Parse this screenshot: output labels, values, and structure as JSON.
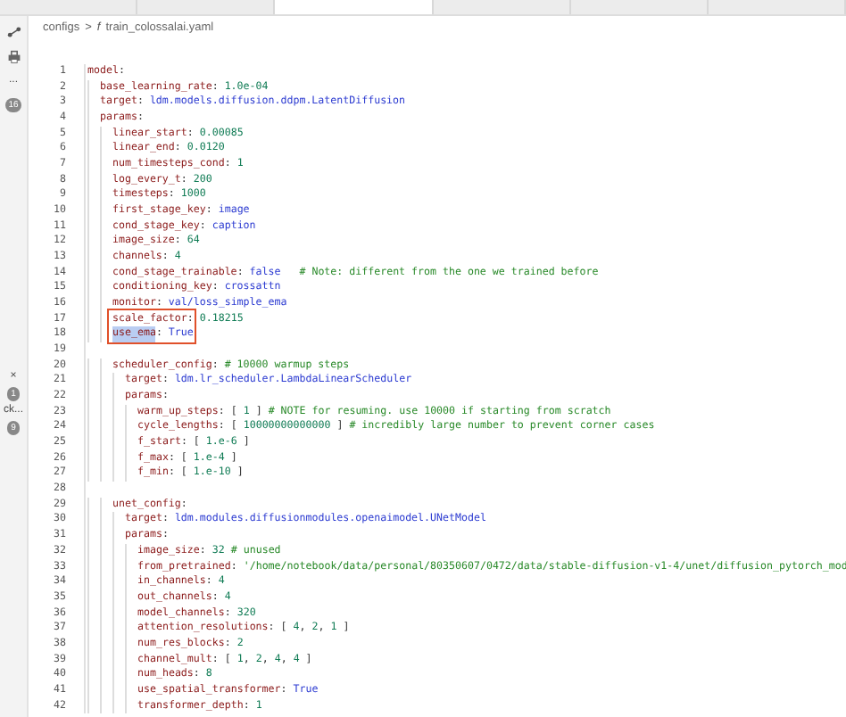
{
  "tabs": [
    {
      "selected": false
    },
    {
      "selected": false
    },
    {
      "selected": true
    },
    {
      "selected": false
    },
    {
      "selected": false
    },
    {
      "selected": false
    }
  ],
  "sidebar": {
    "top": [
      {
        "kind": "nodes"
      },
      {
        "kind": "printer"
      },
      {
        "kind": "text",
        "text": "..."
      },
      {
        "kind": "badge",
        "text": "16"
      }
    ],
    "bottom": [
      {
        "kind": "text",
        "text": "×"
      },
      {
        "kind": "badge",
        "text": "1"
      },
      {
        "kind": "text",
        "text": "ck..."
      },
      {
        "kind": "badge",
        "text": "9"
      }
    ]
  },
  "breadcrumb": {
    "folder": "configs",
    "separator": ">",
    "file_icon": "f",
    "file": "train_colossalai.yaml"
  },
  "lines": [
    {
      "n": "1",
      "tokens": [
        {
          "kind": "key",
          "text": "model"
        },
        {
          "kind": "plain",
          "text": ":"
        }
      ]
    },
    {
      "n": "2",
      "tokens": [
        {
          "kind": "key",
          "text": "  base_learning_rate"
        },
        {
          "kind": "plain",
          "text": ": "
        },
        {
          "kind": "num",
          "text": "1.0e-04"
        }
      ]
    },
    {
      "n": "3",
      "tokens": [
        {
          "kind": "key",
          "text": "  target"
        },
        {
          "kind": "plain",
          "text": ": "
        },
        {
          "kind": "str",
          "text": "ldm.models.diffusion.ddpm.LatentDiffusion"
        }
      ]
    },
    {
      "n": "4",
      "tokens": [
        {
          "kind": "key",
          "text": "  params"
        },
        {
          "kind": "plain",
          "text": ":"
        }
      ]
    },
    {
      "n": "5",
      "tokens": [
        {
          "kind": "key",
          "text": "    linear_start"
        },
        {
          "kind": "plain",
          "text": ": "
        },
        {
          "kind": "num",
          "text": "0.00085"
        }
      ]
    },
    {
      "n": "6",
      "tokens": [
        {
          "kind": "key",
          "text": "    linear_end"
        },
        {
          "kind": "plain",
          "text": ": "
        },
        {
          "kind": "num",
          "text": "0.0120"
        }
      ]
    },
    {
      "n": "7",
      "tokens": [
        {
          "kind": "key",
          "text": "    num_timesteps_cond"
        },
        {
          "kind": "plain",
          "text": ": "
        },
        {
          "kind": "num",
          "text": "1"
        }
      ]
    },
    {
      "n": "8",
      "tokens": [
        {
          "kind": "key",
          "text": "    log_every_t"
        },
        {
          "kind": "plain",
          "text": ": "
        },
        {
          "kind": "num",
          "text": "200"
        }
      ]
    },
    {
      "n": "9",
      "tokens": [
        {
          "kind": "key",
          "text": "    timesteps"
        },
        {
          "kind": "plain",
          "text": ": "
        },
        {
          "kind": "num",
          "text": "1000"
        }
      ]
    },
    {
      "n": "10",
      "tokens": [
        {
          "kind": "key",
          "text": "    first_stage_key"
        },
        {
          "kind": "plain",
          "text": ": "
        },
        {
          "kind": "str",
          "text": "image"
        }
      ]
    },
    {
      "n": "11",
      "tokens": [
        {
          "kind": "key",
          "text": "    cond_stage_key"
        },
        {
          "kind": "plain",
          "text": ": "
        },
        {
          "kind": "str",
          "text": "caption"
        }
      ]
    },
    {
      "n": "12",
      "tokens": [
        {
          "kind": "key",
          "text": "    image_size"
        },
        {
          "kind": "plain",
          "text": ": "
        },
        {
          "kind": "num",
          "text": "64"
        }
      ]
    },
    {
      "n": "13",
      "tokens": [
        {
          "kind": "key",
          "text": "    channels"
        },
        {
          "kind": "plain",
          "text": ": "
        },
        {
          "kind": "num",
          "text": "4"
        }
      ]
    },
    {
      "n": "14",
      "tokens": [
        {
          "kind": "key",
          "text": "    cond_stage_trainable"
        },
        {
          "kind": "plain",
          "text": ": "
        },
        {
          "kind": "str",
          "text": "false   "
        },
        {
          "kind": "comment",
          "text": "# Note: different from the one we trained before"
        }
      ]
    },
    {
      "n": "15",
      "tokens": [
        {
          "kind": "key",
          "text": "    conditioning_key"
        },
        {
          "kind": "plain",
          "text": ": "
        },
        {
          "kind": "str",
          "text": "crossattn"
        }
      ]
    },
    {
      "n": "16",
      "tokens": [
        {
          "kind": "key",
          "text": "    monitor"
        },
        {
          "kind": "plain",
          "text": ": "
        },
        {
          "kind": "str",
          "text": "val/loss_simple_ema"
        }
      ]
    },
    {
      "n": "17",
      "boxed": true,
      "tokens": [
        {
          "kind": "key",
          "text": "    scale_factor"
        },
        {
          "kind": "plain",
          "text": ": "
        },
        {
          "kind": "num",
          "text": "0.18215"
        }
      ]
    },
    {
      "n": "18",
      "tokens": [
        {
          "kind": "key",
          "text": "    use_ema",
          "selected": true
        },
        {
          "kind": "plain",
          "text": ": "
        },
        {
          "kind": "str",
          "text": "True"
        }
      ]
    },
    {
      "n": "19"
    },
    {
      "n": "20",
      "tokens": [
        {
          "kind": "key",
          "text": "    scheduler_config"
        },
        {
          "kind": "plain",
          "text": ": "
        },
        {
          "kind": "comment",
          "text": "# 10000 warmup steps"
        }
      ]
    },
    {
      "n": "21",
      "tokens": [
        {
          "kind": "key",
          "text": "      target"
        },
        {
          "kind": "plain",
          "text": ": "
        },
        {
          "kind": "str",
          "text": "ldm.lr_scheduler.LambdaLinearScheduler"
        }
      ]
    },
    {
      "n": "22",
      "tokens": [
        {
          "kind": "key",
          "text": "      params"
        },
        {
          "kind": "plain",
          "text": ":"
        }
      ]
    },
    {
      "n": "23",
      "tokens": [
        {
          "kind": "key",
          "text": "        warm_up_steps"
        },
        {
          "kind": "plain",
          "text": ": [ "
        },
        {
          "kind": "num",
          "text": "1"
        },
        {
          "kind": "plain",
          "text": " ] "
        },
        {
          "kind": "comment",
          "text": "# NOTE for resuming. use 10000 if starting from scratch"
        }
      ]
    },
    {
      "n": "24",
      "tokens": [
        {
          "kind": "key",
          "text": "        cycle_lengths"
        },
        {
          "kind": "plain",
          "text": ": [ "
        },
        {
          "kind": "num",
          "text": "10000000000000"
        },
        {
          "kind": "plain",
          "text": " ] "
        },
        {
          "kind": "comment",
          "text": "# incredibly large number to prevent corner cases"
        }
      ]
    },
    {
      "n": "25",
      "tokens": [
        {
          "kind": "key",
          "text": "        f_start"
        },
        {
          "kind": "plain",
          "text": ": [ "
        },
        {
          "kind": "num",
          "text": "1.e-6"
        },
        {
          "kind": "plain",
          "text": " ]"
        }
      ]
    },
    {
      "n": "26",
      "tokens": [
        {
          "kind": "key",
          "text": "        f_max"
        },
        {
          "kind": "plain",
          "text": ": [ "
        },
        {
          "kind": "num",
          "text": "1.e-4"
        },
        {
          "kind": "plain",
          "text": " ]"
        }
      ]
    },
    {
      "n": "27",
      "tokens": [
        {
          "kind": "key",
          "text": "        f_min"
        },
        {
          "kind": "plain",
          "text": ": [ "
        },
        {
          "kind": "num",
          "text": "1.e-10"
        },
        {
          "kind": "plain",
          "text": " ]"
        }
      ]
    },
    {
      "n": "28"
    },
    {
      "n": "29",
      "tokens": [
        {
          "kind": "key",
          "text": "    unet_config"
        },
        {
          "kind": "plain",
          "text": ":"
        }
      ]
    },
    {
      "n": "30",
      "tokens": [
        {
          "kind": "key",
          "text": "      target"
        },
        {
          "kind": "plain",
          "text": ": "
        },
        {
          "kind": "str",
          "text": "ldm.modules.diffusionmodules.openaimodel.UNetModel"
        }
      ]
    },
    {
      "n": "31",
      "tokens": [
        {
          "kind": "key",
          "text": "      params"
        },
        {
          "kind": "plain",
          "text": ":"
        }
      ]
    },
    {
      "n": "32",
      "tokens": [
        {
          "kind": "key",
          "text": "        image_size"
        },
        {
          "kind": "plain",
          "text": ": "
        },
        {
          "kind": "num",
          "text": "32 "
        },
        {
          "kind": "comment",
          "text": "# unused"
        }
      ]
    },
    {
      "n": "33",
      "tokens": [
        {
          "kind": "key",
          "text": "        from_pretrained"
        },
        {
          "kind": "plain",
          "text": ": "
        },
        {
          "kind": "comment",
          "text": "'/home/notebook/data/personal/80350607/0472/data/stable-diffusion-v1-4/unet/diffusion_pytorch_mod"
        }
      ]
    },
    {
      "n": "34",
      "tokens": [
        {
          "kind": "key",
          "text": "        in_channels"
        },
        {
          "kind": "plain",
          "text": ": "
        },
        {
          "kind": "num",
          "text": "4"
        }
      ]
    },
    {
      "n": "35",
      "tokens": [
        {
          "kind": "key",
          "text": "        out_channels"
        },
        {
          "kind": "plain",
          "text": ": "
        },
        {
          "kind": "num",
          "text": "4"
        }
      ]
    },
    {
      "n": "36",
      "tokens": [
        {
          "kind": "key",
          "text": "        model_channels"
        },
        {
          "kind": "plain",
          "text": ": "
        },
        {
          "kind": "num",
          "text": "320"
        }
      ]
    },
    {
      "n": "37",
      "tokens": [
        {
          "kind": "key",
          "text": "        attention_resolutions"
        },
        {
          "kind": "plain",
          "text": ": [ "
        },
        {
          "kind": "num",
          "text": "4"
        },
        {
          "kind": "plain",
          "text": ", "
        },
        {
          "kind": "num",
          "text": "2"
        },
        {
          "kind": "plain",
          "text": ", "
        },
        {
          "kind": "num",
          "text": "1"
        },
        {
          "kind": "plain",
          "text": " ]"
        }
      ]
    },
    {
      "n": "38",
      "tokens": [
        {
          "kind": "key",
          "text": "        num_res_blocks"
        },
        {
          "kind": "plain",
          "text": ": "
        },
        {
          "kind": "num",
          "text": "2"
        }
      ]
    },
    {
      "n": "39",
      "tokens": [
        {
          "kind": "key",
          "text": "        channel_mult"
        },
        {
          "kind": "plain",
          "text": ": [ "
        },
        {
          "kind": "num",
          "text": "1"
        },
        {
          "kind": "plain",
          "text": ", "
        },
        {
          "kind": "num",
          "text": "2"
        },
        {
          "kind": "plain",
          "text": ", "
        },
        {
          "kind": "num",
          "text": "4"
        },
        {
          "kind": "plain",
          "text": ", "
        },
        {
          "kind": "num",
          "text": "4"
        },
        {
          "kind": "plain",
          "text": " ]"
        }
      ]
    },
    {
      "n": "40",
      "tokens": [
        {
          "kind": "key",
          "text": "        num_heads"
        },
        {
          "kind": "plain",
          "text": ": "
        },
        {
          "kind": "num",
          "text": "8"
        }
      ]
    },
    {
      "n": "41",
      "tokens": [
        {
          "kind": "key",
          "text": "        use_spatial_transformer"
        },
        {
          "kind": "plain",
          "text": ": "
        },
        {
          "kind": "str",
          "text": "True"
        }
      ]
    },
    {
      "n": "42",
      "tokens": [
        {
          "kind": "key",
          "text": "        transformer_depth"
        },
        {
          "kind": "plain",
          "text": ": "
        },
        {
          "kind": "num",
          "text": "1"
        }
      ]
    }
  ]
}
